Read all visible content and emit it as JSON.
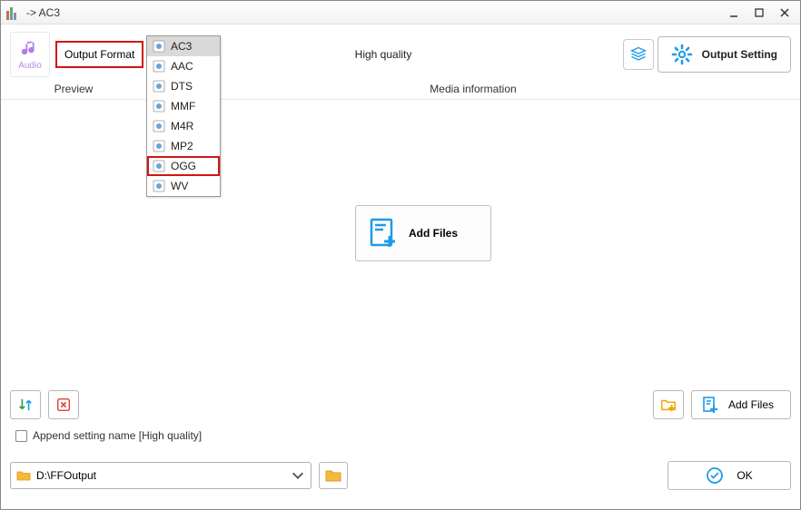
{
  "window": {
    "title": " -> AC3"
  },
  "top": {
    "audio_label": "Audio",
    "output_format_label": "Output Format",
    "quality_label": "High quality",
    "output_setting_label": "Output Setting"
  },
  "subheaders": {
    "preview": "Preview",
    "media_info": "Media information"
  },
  "format_list": {
    "items": [
      {
        "label": "AC3",
        "icon": "audio-ac3-icon",
        "selected": true,
        "highlighted": false
      },
      {
        "label": "AAC",
        "icon": "audio-aac-icon",
        "selected": false,
        "highlighted": false
      },
      {
        "label": "DTS",
        "icon": "audio-dts-icon",
        "selected": false,
        "highlighted": false
      },
      {
        "label": "MMF",
        "icon": "audio-mmf-icon",
        "selected": false,
        "highlighted": false
      },
      {
        "label": "M4R",
        "icon": "audio-m4r-icon",
        "selected": false,
        "highlighted": false
      },
      {
        "label": "MP2",
        "icon": "audio-mp2-icon",
        "selected": false,
        "highlighted": false
      },
      {
        "label": "OGG",
        "icon": "audio-ogg-icon",
        "selected": false,
        "highlighted": true
      },
      {
        "label": "WV",
        "icon": "audio-wv-icon",
        "selected": false,
        "highlighted": false
      }
    ]
  },
  "center": {
    "add_files_label": "Add Files"
  },
  "bottom": {
    "checkbox_label": "Append setting name [High quality]",
    "add_files_label": "Add Files",
    "output_path": "D:\\FFOutput",
    "ok_label": "OK"
  },
  "icons": {
    "audio": "audio-icon",
    "layers": "layers-icon",
    "gear": "gear-icon",
    "sort": "sort-icon",
    "delete": "delete-icon",
    "folder_add": "folder-add-icon",
    "file_add": "file-add-icon",
    "folder": "folder-icon",
    "check_circle": "check-circle-icon",
    "chevron_down": "chevron-down-icon"
  },
  "colors": {
    "accent": "#1e9be9",
    "highlight_red": "#d31414",
    "folder": "#f7b93b"
  }
}
